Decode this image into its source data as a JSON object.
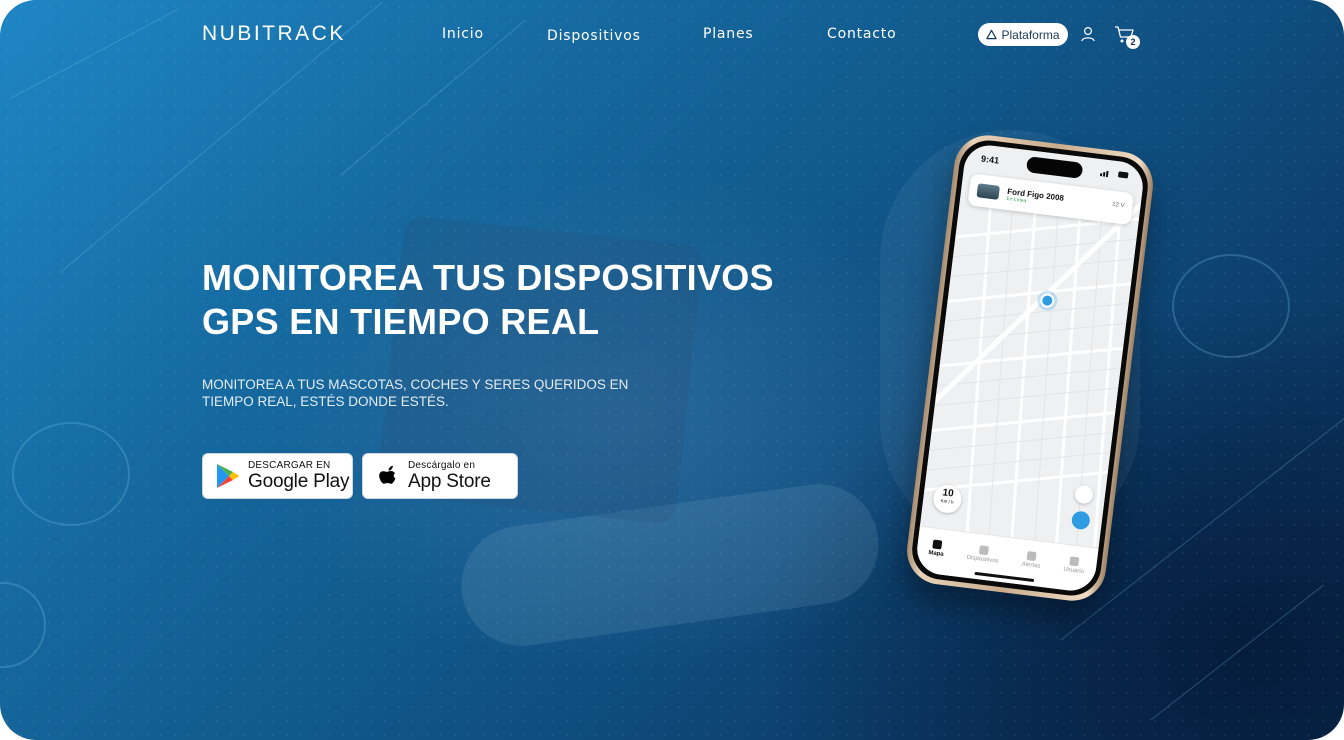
{
  "nav": {
    "logo": "NUBITRACK",
    "links": [
      "Inicio",
      "Dispositivos",
      "Planes",
      "Contacto"
    ],
    "platform_button": "Plataforma",
    "cart_count": "2",
    "icons": [
      "user-icon",
      "cart-icon",
      "platform-triangle-icon"
    ]
  },
  "hero": {
    "title_line1": "MONITOREA TUS DISPOSITIVOS",
    "title_line2_bold": "GPS",
    "title_line2_rest": " EN TIEMPO REAL",
    "subtitle": "MONITOREA A TUS MASCOTAS, COCHES Y SERES QUERIDOS EN TIEMPO REAL, ESTÉS DONDE ESTÉS."
  },
  "store_buttons": {
    "google": {
      "small": "DESCARGAR EN",
      "big": "Google Play"
    },
    "apple": {
      "small": "Descárgalo en",
      "big": "App Store"
    }
  },
  "phone": {
    "time": "9:41",
    "vehicle_name": "Ford Figo 2008",
    "vehicle_status": "En Línea",
    "vehicle_meta": "12 V",
    "speed_value": "10",
    "speed_unit": "Km / h",
    "tabs": [
      "Mapa",
      "Dispositivos",
      "Alertas",
      "Usuario"
    ],
    "active_tab": "Mapa"
  },
  "colors": {
    "accent_blue": "#2f9be0",
    "bg_top": "#1f86c4",
    "bg_bottom": "#082a4f",
    "text_dark": "#173a5e"
  }
}
